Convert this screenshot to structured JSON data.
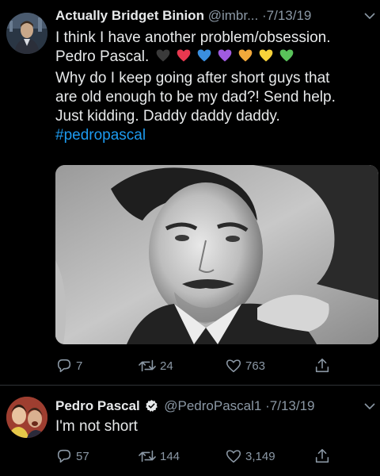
{
  "tweets": [
    {
      "display_name": "Actually Bridget Binion",
      "handle": "@imbr...",
      "separator": "·",
      "date": "7/13/19",
      "text_lines": [
        "I think I have another problem/obsession.",
        "Pedro Pascal.",
        "Why do I keep going after short guys that",
        "are old enough to be my dad?! Send help.",
        "Just kidding. Daddy daddy daddy."
      ],
      "hashtag": "#pedropascal",
      "heart_emojis": [
        "black-heart",
        "red-heart",
        "blue-heart",
        "purple-heart",
        "orange-heart",
        "yellow-heart",
        "green-heart"
      ],
      "heart_colors": [
        "#3a3a3a",
        "#e8384f",
        "#3a8fe0",
        "#a05be0",
        "#f2a93b",
        "#f7d23a",
        "#59c25a"
      ],
      "has_media": true,
      "replies": "7",
      "retweets": "24",
      "likes": "763"
    },
    {
      "display_name": "Pedro Pascal",
      "verified": true,
      "handle": "@PedroPascal1",
      "separator": "·",
      "date": "7/13/19",
      "text_lines": [
        "I'm not short"
      ],
      "replies": "57",
      "retweets": "144",
      "likes": "3,149"
    }
  ],
  "icons": {
    "reply": "reply-icon",
    "retweet": "retweet-icon",
    "like": "heart-icon",
    "share": "share-icon",
    "more": "chevron-down-icon",
    "verified": "verified-badge-icon"
  },
  "colors": {
    "background": "#000000",
    "text": "#e7e9ea",
    "secondary": "#8b98a5",
    "link": "#1d9bf0"
  }
}
